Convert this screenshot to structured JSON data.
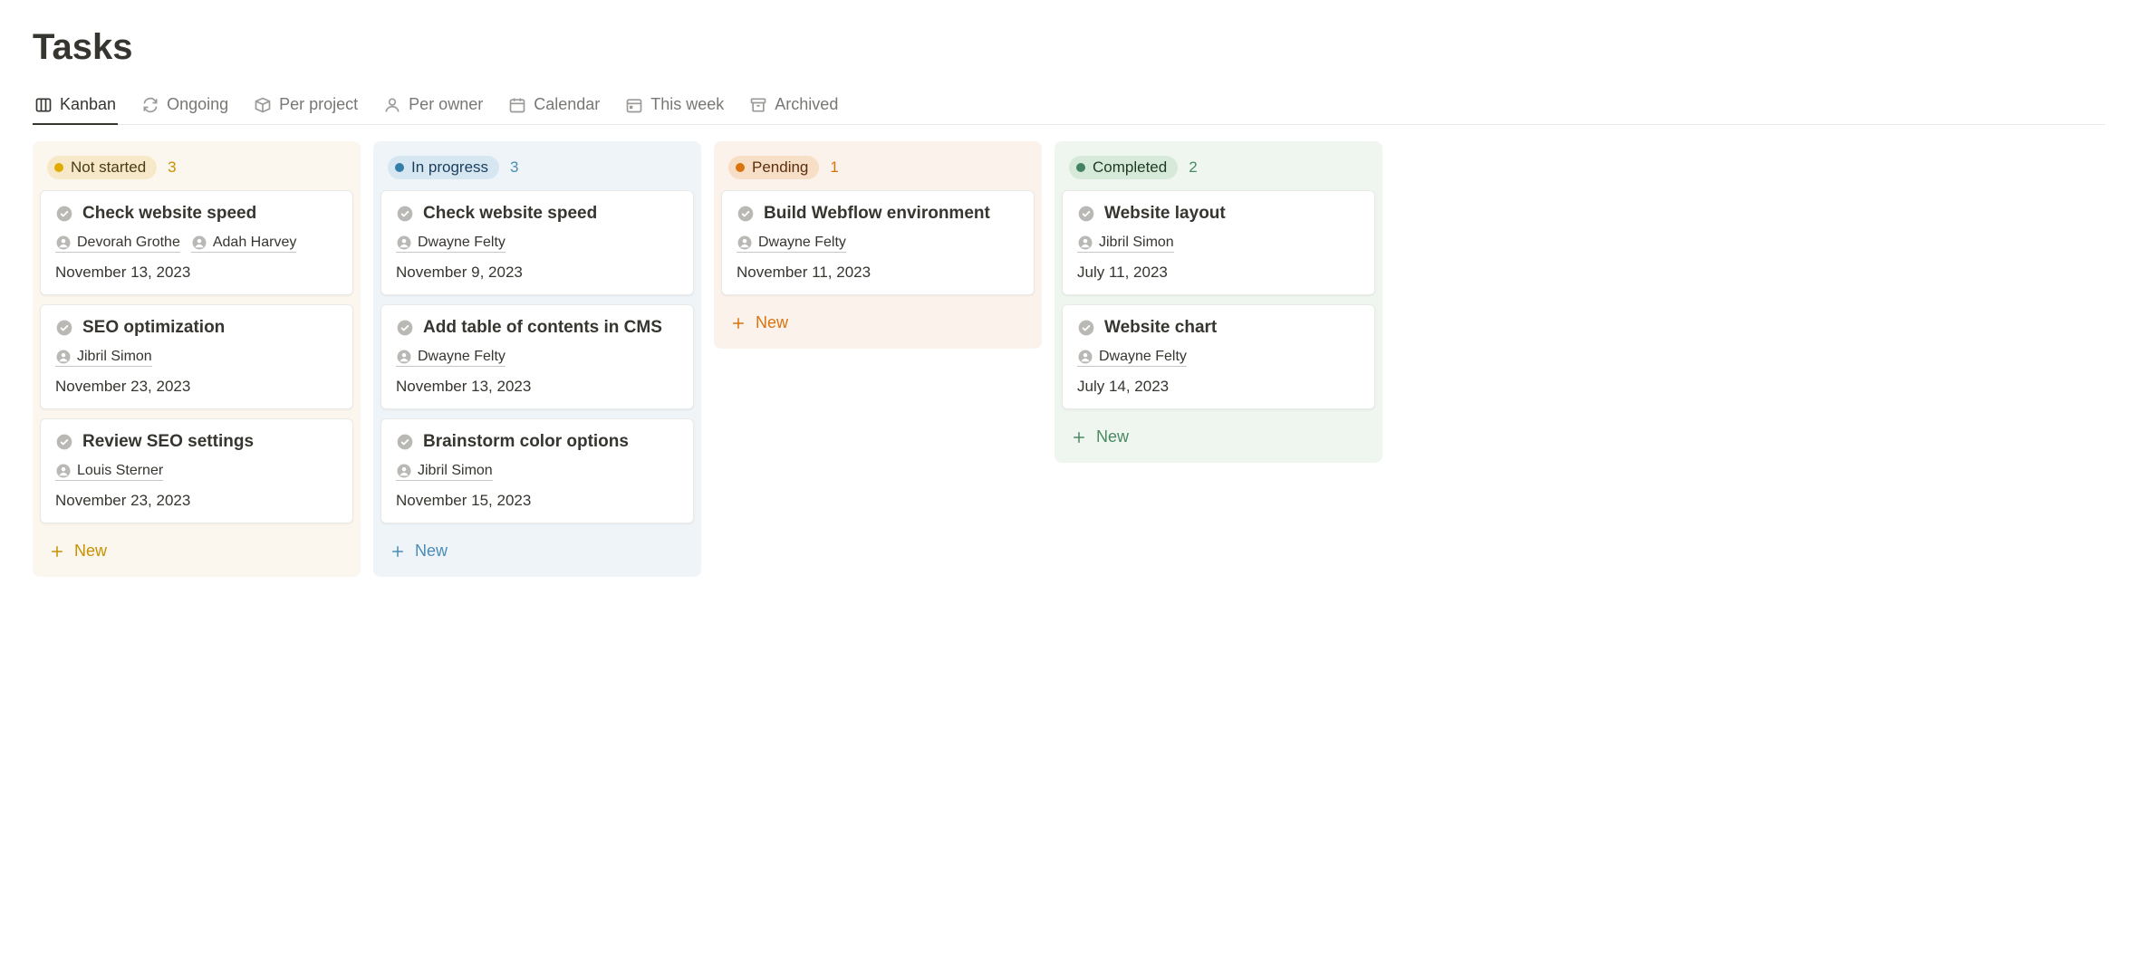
{
  "page": {
    "title": "Tasks"
  },
  "tabs": [
    {
      "label": "Kanban",
      "icon": "board",
      "active": true
    },
    {
      "label": "Ongoing",
      "icon": "refresh",
      "active": false
    },
    {
      "label": "Per project",
      "icon": "box",
      "active": false
    },
    {
      "label": "Per owner",
      "icon": "person",
      "active": false
    },
    {
      "label": "Calendar",
      "icon": "calendar",
      "active": false
    },
    {
      "label": "This week",
      "icon": "week",
      "active": false
    },
    {
      "label": "Archived",
      "icon": "archive",
      "active": false
    }
  ],
  "newLabel": "New",
  "columns": [
    {
      "id": "notstarted",
      "label": "Not started",
      "count": "3",
      "pillClass": "pill-notstarted",
      "colClass": "col-notstarted",
      "dotClass": "dot-yellow",
      "countClass": "count-yellow",
      "newClass": "new-yellow",
      "cards": [
        {
          "title": "Check website speed",
          "assignees": [
            "Devorah Grothe",
            "Adah Harvey"
          ],
          "date": "November 13, 2023"
        },
        {
          "title": "SEO optimization",
          "assignees": [
            "Jibril Simon"
          ],
          "date": "November 23, 2023"
        },
        {
          "title": "Review SEO settings",
          "assignees": [
            "Louis Sterner"
          ],
          "date": "November 23, 2023"
        }
      ]
    },
    {
      "id": "inprogress",
      "label": "In progress",
      "count": "3",
      "pillClass": "pill-inprogress",
      "colClass": "col-inprogress",
      "dotClass": "dot-blue",
      "countClass": "count-blue",
      "newClass": "new-blue",
      "cards": [
        {
          "title": "Check website speed",
          "assignees": [
            "Dwayne Felty"
          ],
          "date": "November 9, 2023"
        },
        {
          "title": "Add table of contents in CMS",
          "assignees": [
            "Dwayne Felty"
          ],
          "date": "November 13, 2023"
        },
        {
          "title": "Brainstorm color options",
          "assignees": [
            "Jibril Simon"
          ],
          "date": "November 15, 2023"
        }
      ]
    },
    {
      "id": "pending",
      "label": "Pending",
      "count": "1",
      "pillClass": "pill-pending",
      "colClass": "col-pending",
      "dotClass": "dot-orange",
      "countClass": "count-orange",
      "newClass": "new-orange",
      "cards": [
        {
          "title": "Build Webflow environment",
          "assignees": [
            "Dwayne Felty"
          ],
          "date": "November 11, 2023"
        }
      ]
    },
    {
      "id": "completed",
      "label": "Completed",
      "count": "2",
      "pillClass": "pill-completed",
      "colClass": "col-completed",
      "dotClass": "dot-green",
      "countClass": "count-green",
      "newClass": "new-green",
      "cards": [
        {
          "title": "Website layout",
          "assignees": [
            "Jibril Simon"
          ],
          "date": "July 11, 2023"
        },
        {
          "title": "Website chart",
          "assignees": [
            "Dwayne Felty"
          ],
          "date": "July 14, 2023"
        }
      ]
    }
  ]
}
